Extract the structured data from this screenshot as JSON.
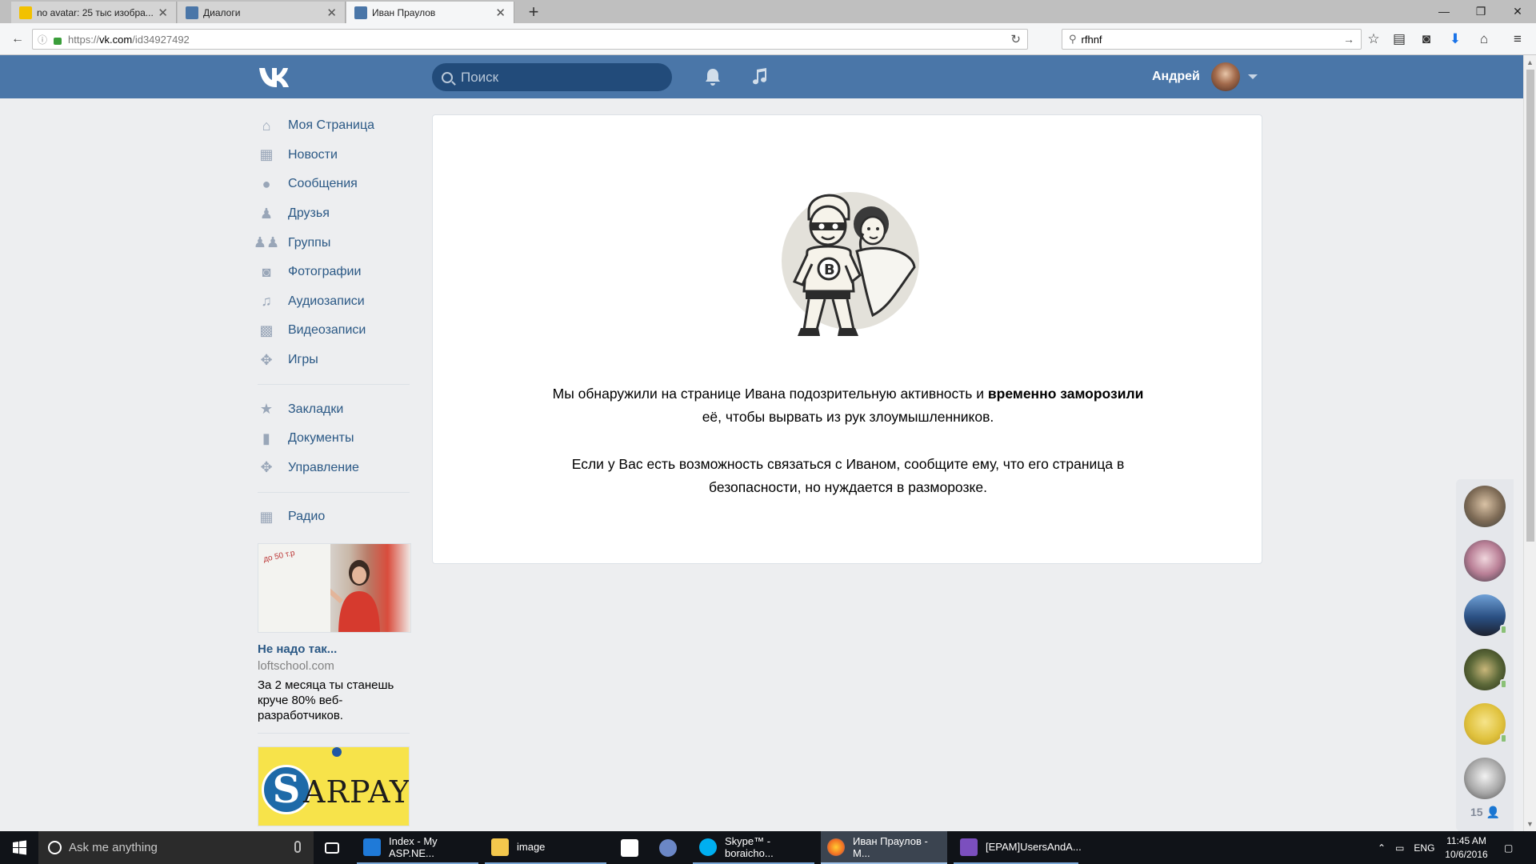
{
  "browser": {
    "tabs": [
      {
        "title": "no avatar: 25 тыс изобра...",
        "icon": "yandex-images-icon",
        "color": "#f2c100"
      },
      {
        "title": "Диалоги",
        "icon": "vk-icon",
        "color": "#4a76a8"
      },
      {
        "title": "Иван Праулов",
        "icon": "vk-icon",
        "color": "#4a76a8"
      }
    ],
    "url_prefix": "https://",
    "url_host": "vk.com",
    "url_path": "/id34927492",
    "search_value": "rfhnf"
  },
  "vk": {
    "search_placeholder": "Поиск",
    "user_name": "Андрей",
    "accent": "#4a76a8",
    "menu": [
      {
        "label": "Моя Страница",
        "icon": "home-icon"
      },
      {
        "label": "Новости",
        "icon": "news-icon"
      },
      {
        "label": "Сообщения",
        "icon": "messages-icon"
      },
      {
        "label": "Друзья",
        "icon": "friends-icon"
      },
      {
        "label": "Группы",
        "icon": "groups-icon"
      },
      {
        "label": "Фотографии",
        "icon": "camera-icon"
      },
      {
        "label": "Аудиозаписи",
        "icon": "music-icon"
      },
      {
        "label": "Видеозаписи",
        "icon": "video-icon"
      },
      {
        "label": "Игры",
        "icon": "gamepad-icon"
      }
    ],
    "menu2": [
      {
        "label": "Закладки",
        "icon": "star-icon"
      },
      {
        "label": "Документы",
        "icon": "document-icon"
      },
      {
        "label": "Управление",
        "icon": "gamepad-icon"
      }
    ],
    "menu3": [
      {
        "label": "Радио",
        "icon": "apps-icon"
      }
    ],
    "ad": {
      "title": "Не надо так...",
      "domain": "loftschool.com",
      "text": "За 2 месяца ты станешь круче 80% веб-разработчиков.",
      "board_text": "до 50 т.р"
    },
    "ad2_brand": "ARPAY",
    "ad2_letter": "S",
    "frozen": {
      "p1_pre": "Мы обнаружили на странице Ивана подозрительную активность и ",
      "p1_bold": "временно заморозили",
      "p1_post": " её, чтобы вырвать из рук злоумышленников.",
      "p2": "Если у Вас есть возможность связаться с Иваном, сообщите ему, что его страница в безопасности, но нуждается в разморозке."
    },
    "friends_count": "15"
  },
  "taskbar": {
    "search_placeholder": "Ask me anything",
    "apps": [
      {
        "label": "Index - My ASP.NE...",
        "icon": "edge-icon"
      },
      {
        "label": "image",
        "icon": "folder-icon"
      },
      {
        "label": "",
        "icon": "store-icon"
      },
      {
        "label": "",
        "icon": "app-icon"
      },
      {
        "label": "Skype™ - boraicho...",
        "icon": "skype-icon"
      },
      {
        "label": "Иван Праулов - M...",
        "icon": "firefox-icon"
      },
      {
        "label": "[EPAM]UsersAndA...",
        "icon": "visual-studio-icon"
      }
    ],
    "lang": "ENG",
    "time": "11:45 AM",
    "date": "10/6/2016"
  }
}
